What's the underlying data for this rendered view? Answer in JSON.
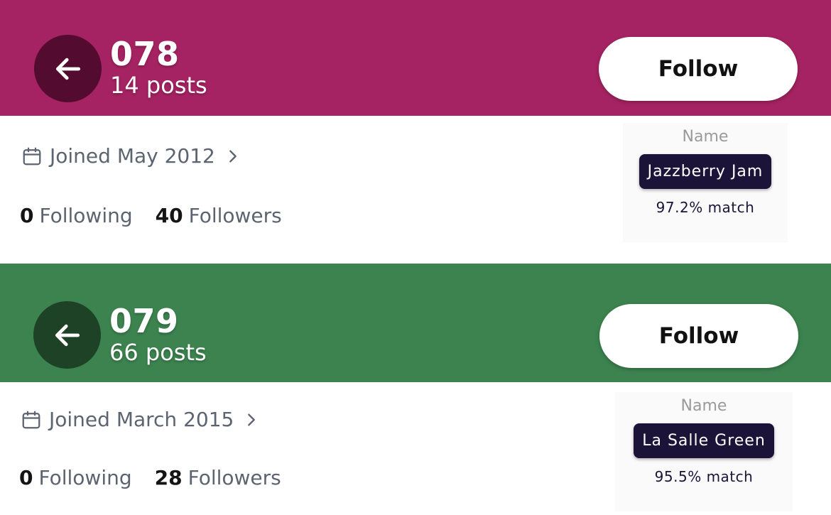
{
  "cards": [
    {
      "id": "078",
      "posts": "14 posts",
      "follow_label": "Follow",
      "joined": "Joined May 2012",
      "following_count": "0",
      "following_label": "Following",
      "followers_count": "40",
      "followers_label": "Followers",
      "name_label": "Name",
      "color_name": "Jazzberry Jam",
      "match": "97.2% match",
      "header_color": "#A52362",
      "back_button_color": "#530B30"
    },
    {
      "id": "079",
      "posts": "66 posts",
      "follow_label": "Follow",
      "joined": "Joined March 2015",
      "following_count": "0",
      "following_label": "Following",
      "followers_count": "28",
      "followers_label": "Followers",
      "name_label": "Name",
      "color_name": "La Salle Green",
      "match": "95.5% match",
      "header_color": "#3C834F",
      "back_button_color": "#1D4226"
    }
  ],
  "icons": {
    "back": "arrow-left-icon",
    "calendar": "calendar-icon",
    "chevron": "chevron-right-icon"
  }
}
